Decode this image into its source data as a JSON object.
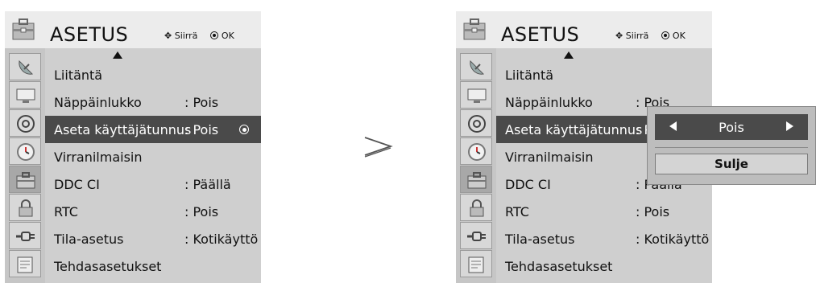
{
  "menu": {
    "title": "ASETUS",
    "hint_move": "Siirrä",
    "hint_ok": "OK",
    "items": [
      {
        "label": "Liitäntä",
        "value": ""
      },
      {
        "label": "Näppäinlukko",
        "value": ": Pois"
      },
      {
        "label": "Aseta käyttäjätunnus",
        "value": ": Pois"
      },
      {
        "label": "Virranilmaisin",
        "value": ""
      },
      {
        "label": "DDC CI",
        "value": ": Päällä"
      },
      {
        "label": "RTC",
        "value": ": Pois"
      },
      {
        "label": "Tila-asetus",
        "value": ": Kotikäyttö"
      },
      {
        "label": "Tehdasasetukset",
        "value": ""
      }
    ],
    "selected_index": 2
  },
  "popup": {
    "value": "Pois",
    "close_label": "Sulje"
  },
  "icons": [
    "satellite-dish-icon",
    "monitor-icon",
    "disc-icon",
    "clock-icon",
    "toolbox-icon",
    "lock-icon",
    "input-plug-icon",
    "settings-sheet-icon"
  ],
  "separator_symbol": ">"
}
